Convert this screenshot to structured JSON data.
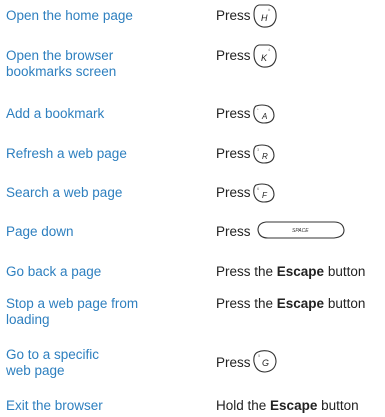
{
  "rows": [
    {
      "action": "Open the home page",
      "press": "Press",
      "key_letter": "H",
      "key_number": "#"
    },
    {
      "action": "Open the browser\nbookmarks screen",
      "press": "Press",
      "key_letter": "K",
      "key_number": "4"
    },
    {
      "action": "Add a bookmark",
      "press": "Press",
      "key_letter": "A",
      "key_number": "*"
    },
    {
      "action": "Refresh a web page",
      "press": "Press",
      "key_letter": "R",
      "key_number": "3"
    },
    {
      "action": "Search a web page",
      "press": "Press",
      "key_letter": "F",
      "key_number": "6"
    },
    {
      "action": "Page down",
      "press": "Press",
      "key_label": "SPACE"
    },
    {
      "action": "Go back a page",
      "pre": "Press the ",
      "bold": "Escape",
      "post": " button"
    },
    {
      "action": "Stop a web page from\nloading",
      "pre": "Press the ",
      "bold": "Escape",
      "post": " button"
    },
    {
      "action": "Go to a specific\nweb page",
      "press": "Press",
      "key_letter": "G",
      "key_number": "5"
    },
    {
      "action": "Exit the browser",
      "pre": "Hold the ",
      "bold": "Escape",
      "post": " button"
    }
  ]
}
